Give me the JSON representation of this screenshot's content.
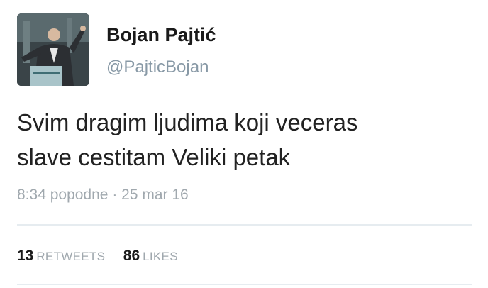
{
  "user": {
    "display_name": "Bojan Pajtić",
    "handle": "@PajticBojan",
    "avatar_icon": "profile-photo"
  },
  "tweet": {
    "lines": [
      "Svim dragim ljudima koji veceras",
      "slave cestitam Veliki petak"
    ],
    "time": "8:34 popodne",
    "separator": "·",
    "date": "25 mar 16"
  },
  "stats": {
    "retweets_count": "13",
    "retweets_label": "RETWEETS",
    "likes_count": "86",
    "likes_label": "LIKES"
  },
  "colors": {
    "muted": "#a0a8ae",
    "text": "#222222",
    "divider": "#e6ecf0"
  }
}
